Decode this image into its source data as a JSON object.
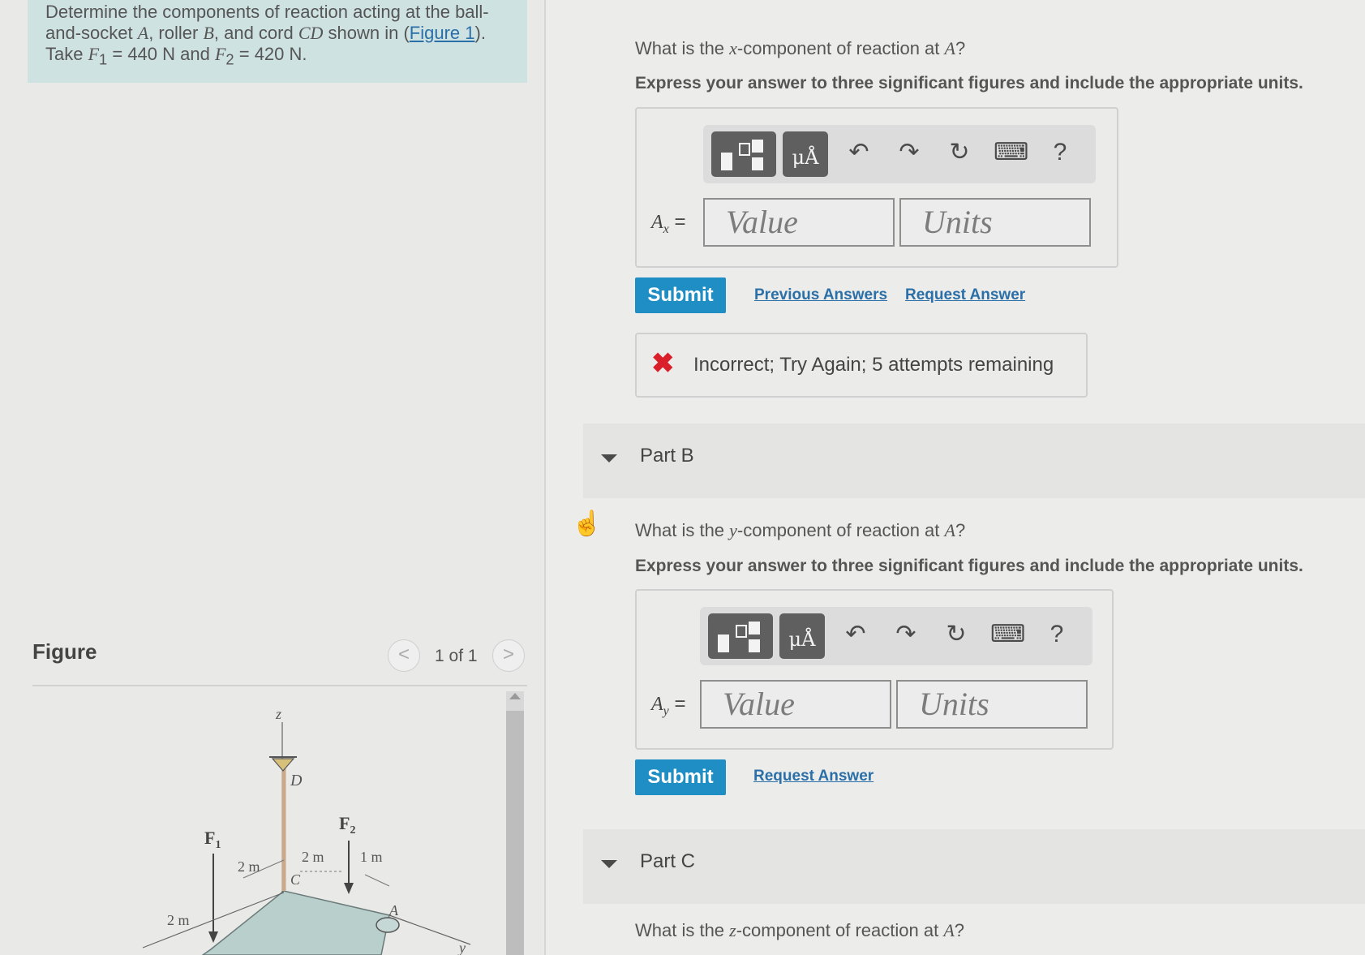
{
  "problem": {
    "line1": "Determine the components of reaction acting at the ball-",
    "line2_pre": "and-socket ",
    "A": "A",
    "line2_mid1": ", roller ",
    "B": "B",
    "line2_mid2": ", and cord ",
    "CD": "CD",
    "line2_mid3": " shown in (",
    "figure_link": "Figure 1",
    "line2_post": ").",
    "line3_pre": "Take ",
    "F1": "F",
    "F1_sub": "1",
    "F1_val": " = 440 N",
    "and": " and ",
    "F2": "F",
    "F2_sub": "2",
    "F2_val": " = 420 N."
  },
  "figure": {
    "label": "Figure",
    "count": "1 of 1",
    "prev": "<",
    "next": ">",
    "labels": {
      "z": "z",
      "D": "D",
      "F1": "F",
      "F1_sub": "1",
      "F2": "F",
      "F2_sub": "2",
      "dim1": "2 m",
      "dim2": "2 m",
      "dim3": "1 m",
      "dim4": "2 m",
      "C": "C",
      "A": "A",
      "y": "y"
    }
  },
  "partA": {
    "question_pre": "What is the ",
    "question_var": "x",
    "question_mid": "-component of reaction at ",
    "question_pt": "A",
    "question_post": "?",
    "instruction": "Express your answer to three significant figures and include the appropriate units.",
    "label_main": "A",
    "label_sub": "x",
    "label_eq": " =",
    "value_placeholder": "Value",
    "units_placeholder": "Units",
    "submit": "Submit",
    "previous_answers": "Previous Answers",
    "request_answer": "Request Answer",
    "feedback_icon": "✖",
    "feedback": "Incorrect; Try Again; 5 attempts remaining"
  },
  "toolbar": {
    "units_glyph": "μÅ",
    "undo": "↶",
    "redo": "↷",
    "reset": "↻",
    "keyboard": "⌨",
    "help": "?"
  },
  "partB": {
    "title": "Part B",
    "question_pre": "What is the ",
    "question_var": "y",
    "question_mid": "-component of reaction at ",
    "question_pt": "A",
    "question_post": "?",
    "instruction": "Express your answer to three significant figures and include the appropriate units.",
    "label_main": "A",
    "label_sub": "y",
    "label_eq": " =",
    "value_placeholder": "Value",
    "units_placeholder": "Units",
    "submit": "Submit",
    "request_answer": "Request Answer"
  },
  "partC": {
    "title": "Part C",
    "question_pre": "What is the ",
    "question_var": "z",
    "question_mid": "-component of reaction at ",
    "question_pt": "A",
    "question_post": "?"
  },
  "colors": {
    "accent": "#1f8ec5",
    "link": "#2b6fa8",
    "error": "#d9202a",
    "problem_bg": "#cfe2e2"
  }
}
